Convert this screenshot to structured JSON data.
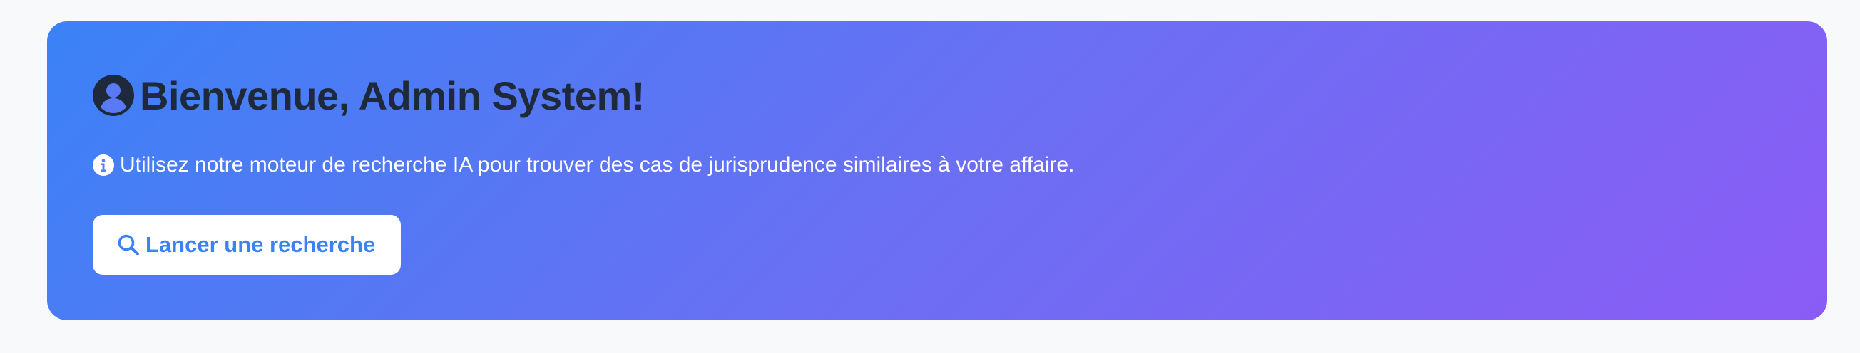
{
  "welcome": {
    "title": "Bienvenue, Admin System!",
    "user_icon": "user-circle-icon",
    "info_icon": "info-circle-icon",
    "info_text": "Utilisez notre moteur de recherche IA pour trouver des cas de jurisprudence similaires à votre affaire.",
    "search_button": {
      "icon": "search-icon",
      "label": "Lancer une recherche"
    }
  },
  "colors": {
    "gradient_start": "#3b82f6",
    "gradient_end": "#8b5cf6",
    "title_text": "#1e293b",
    "button_text": "#3b82f6",
    "button_background": "#ffffff",
    "page_background": "#f8f9fb"
  }
}
